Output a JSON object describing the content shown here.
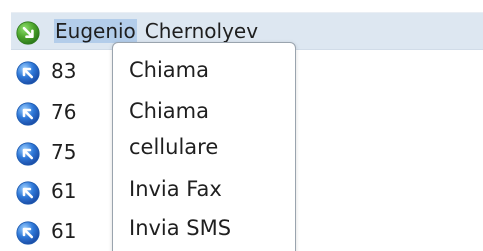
{
  "contact": {
    "first_name": "Eugenio",
    "last_name": "Chernolyev",
    "icon": "green-arrow-icon"
  },
  "left_list": {
    "rows": [
      {
        "value": "83",
        "icon": "blue-arrow-icon"
      },
      {
        "value": "76",
        "icon": "blue-arrow-icon"
      },
      {
        "value": "75",
        "icon": "blue-arrow-icon"
      },
      {
        "value": "61",
        "icon": "blue-arrow-icon"
      },
      {
        "value": "61",
        "icon": "blue-arrow-icon"
      }
    ]
  },
  "context_menu": {
    "items": [
      {
        "label": "Chiama"
      },
      {
        "label": "Chiama\ncellulare"
      },
      {
        "label": "Invia Fax"
      },
      {
        "label": "Invia SMS"
      }
    ]
  },
  "colors": {
    "header_background": "#dde7f1",
    "selected_name_background": "#b3cdea",
    "green_icon": "#4fa72e",
    "blue_icon": "#2f79d9",
    "menu_border": "#9aa4ae",
    "text": "#1f1f1f"
  }
}
